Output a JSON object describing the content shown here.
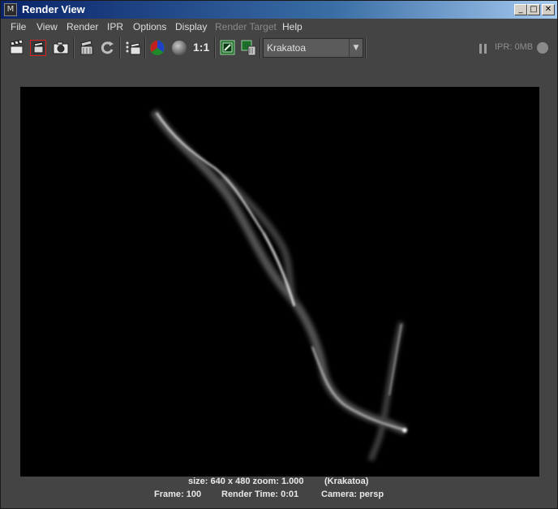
{
  "window": {
    "title": "Render View",
    "controls": {
      "minimize": "_",
      "maximize": "□",
      "close": "✕"
    }
  },
  "menubar": {
    "items": [
      {
        "label": "File",
        "enabled": true
      },
      {
        "label": "View",
        "enabled": true
      },
      {
        "label": "Render",
        "enabled": true
      },
      {
        "label": "IPR",
        "enabled": true
      },
      {
        "label": "Options",
        "enabled": true
      },
      {
        "label": "Display",
        "enabled": true
      },
      {
        "label": "Render Target",
        "enabled": false
      },
      {
        "label": "Help",
        "enabled": true
      }
    ]
  },
  "toolbar": {
    "icons": [
      "render-clapper-icon",
      "render-region-icon",
      "snapshot-camera-icon",
      "ipr-render-icon",
      "refresh-icon",
      "render-sequence-icon",
      "rgb-channels-icon",
      "alpha-channel-icon",
      "image-size-ratio",
      "keep-image-icon",
      "remove-image-icon"
    ],
    "ratio_label": "1:1",
    "renderer": "Krakatoa",
    "ipr_status": "IPR: 0MB"
  },
  "status": {
    "size_zoom": "size: 640 x 480 zoom: 1.000",
    "renderer": "(Krakatoa)",
    "frame": "Frame: 100",
    "render_time": "Render Time: 0:01",
    "camera": "Camera: persp"
  },
  "colors": {
    "panel": "#444444",
    "title_start": "#0a246a",
    "title_end": "#a6caf0",
    "render_bg": "#000000"
  }
}
